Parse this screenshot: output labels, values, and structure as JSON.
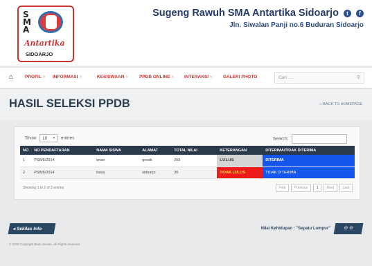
{
  "header": {
    "logo": {
      "line1": "S",
      "line2": "M",
      "line3": "A",
      "script": "Antartika",
      "city": "SIDOARJO"
    },
    "title": "Sugeng Rawuh SMA Antartika Sidoarjo",
    "subtitle": "Jln. Siwalan Panji no.6 Buduran Sidoarjo",
    "social": [
      "twitter-icon",
      "facebook-icon"
    ]
  },
  "nav": {
    "items": [
      "PROFIL",
      "INFORMASI",
      "KESISWAAN",
      "PPDB ONLINE",
      "INTERAKSI",
      "GALERI PHOTO"
    ],
    "search_placeholder": "Cari ....",
    "accent": "#c9342f"
  },
  "page": {
    "title": "HASIL SELEKSI PPDB",
    "back_link": "BACK TO HOMEPAGE"
  },
  "table_controls": {
    "show_label": "Show",
    "show_value": "10",
    "entries_label": "entries",
    "search_label": "Search:"
  },
  "table": {
    "headers": [
      "NO",
      "NO PENDAFTARAN",
      "NAMA SISWA",
      "ALAMAT",
      "TOTAL NILAI",
      "KETERANGAN",
      "DITERIMA/TIDAK DITERIMA"
    ],
    "rows": [
      [
        "1",
        "PSB/5/2014",
        "brian",
        "gresik",
        "265",
        "LULUS",
        "DITERIMA"
      ],
      [
        "2",
        "PSB/6/2014",
        "hasa",
        "sidoarjo",
        "30",
        "TIDAK LULUS",
        "TIDAK DITERIMA"
      ]
    ],
    "info": "Showing 1 to 2 of 2 entries",
    "pager": [
      "First",
      "Previous",
      "1",
      "Next",
      "Last"
    ]
  },
  "footer": {
    "sekilas": "Sekilas Info",
    "nilai": "Nilai Kehidupan : \"Sepatu Lumpur\"",
    "copyright": "© 2016 Copyright Brian Sisaan. All Rights reserved."
  }
}
